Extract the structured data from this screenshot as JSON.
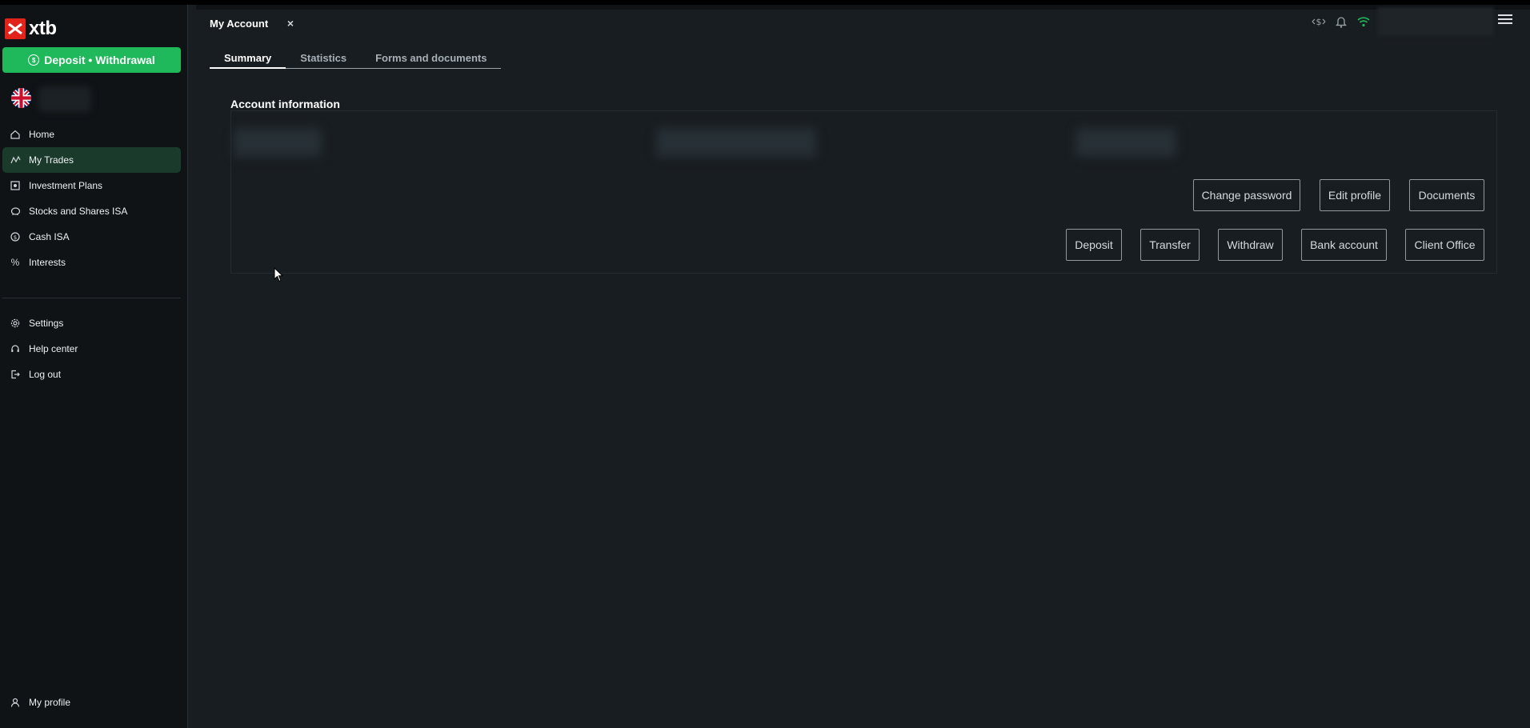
{
  "brand": {
    "name": "xtb",
    "accent": "#e2231a",
    "green": "#1fb85a"
  },
  "sidebar": {
    "deposit_label": "Deposit • Withdrawal",
    "items": [
      {
        "label": "Home",
        "icon": "home-icon"
      },
      {
        "label": "My Trades",
        "icon": "trades-icon",
        "active": true
      },
      {
        "label": "Investment Plans",
        "icon": "plans-icon"
      },
      {
        "label": "Stocks and Shares ISA",
        "icon": "piggy-bank-icon"
      },
      {
        "label": "Cash ISA",
        "icon": "cash-icon"
      },
      {
        "label": "Interests",
        "icon": "percent-icon"
      }
    ],
    "bottom_items": [
      {
        "label": "Settings",
        "icon": "gear-icon"
      },
      {
        "label": "Help center",
        "icon": "headset-icon"
      },
      {
        "label": "Log out",
        "icon": "logout-icon"
      }
    ],
    "profile_label": "My profile"
  },
  "tabs": {
    "active_tab": "My Account",
    "close": "×"
  },
  "subtabs": [
    "Summary",
    "Statistics",
    "Forms and documents"
  ],
  "account": {
    "title": "Account information",
    "buttons_row1": [
      "Change password",
      "Edit profile",
      "Documents"
    ],
    "buttons_row2": [
      "Deposit",
      "Transfer",
      "Withdraw",
      "Bank account",
      "Client Office"
    ]
  }
}
